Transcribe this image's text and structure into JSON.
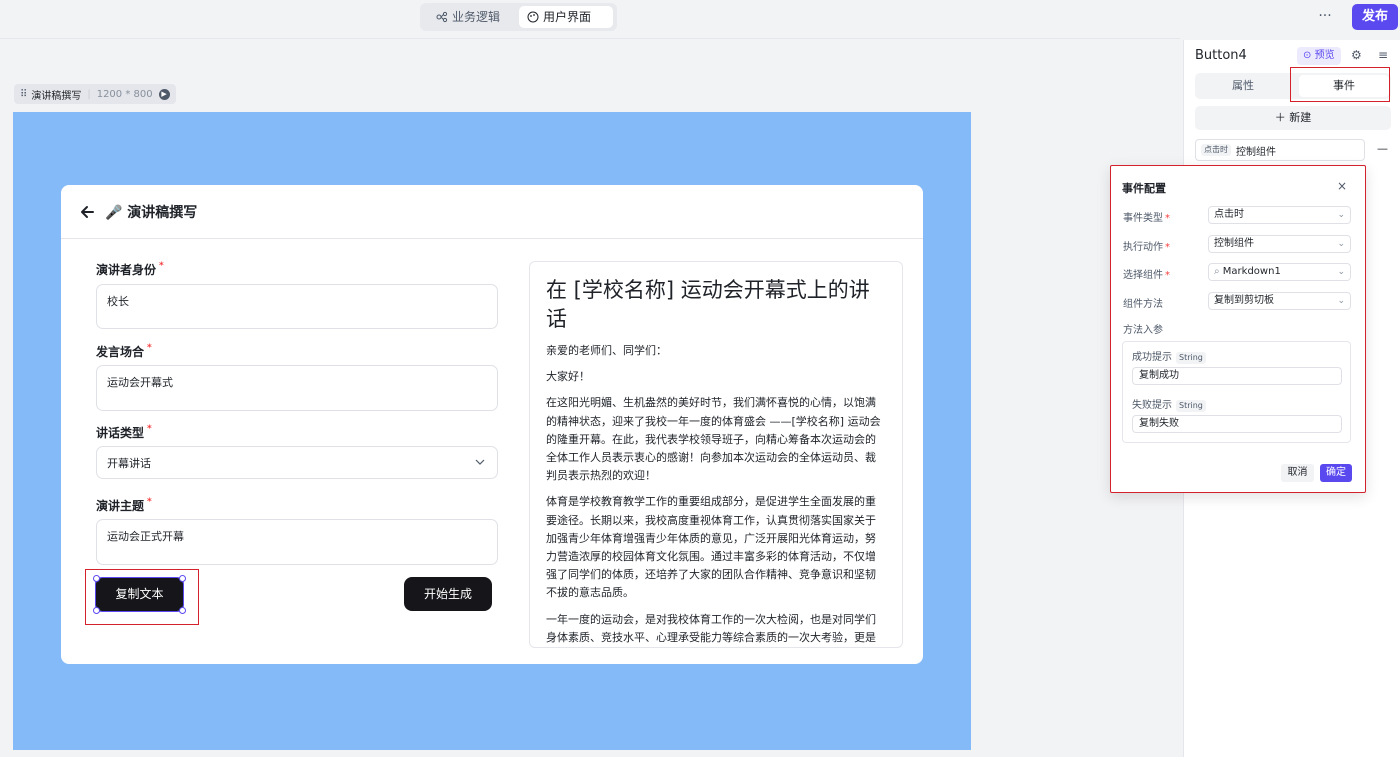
{
  "topbar": {
    "tabs": [
      {
        "label": "业务逻辑",
        "icon": "logic-icon",
        "active": false
      },
      {
        "label": "用户界面",
        "icon": "palette-icon",
        "active": true
      }
    ],
    "more_label": "···",
    "publish_label": "发布"
  },
  "canvas": {
    "page_name": "演讲稿撰写",
    "page_size": "1200 * 800",
    "background_color": "#84baf7"
  },
  "app_card": {
    "title": "🎤 演讲稿撰写",
    "fields": [
      {
        "label": "演讲者身份",
        "value": "校长"
      },
      {
        "label": "发言场合",
        "value": "运动会开幕式"
      },
      {
        "label": "讲话类型",
        "value": "开幕讲话"
      },
      {
        "label": "演讲主题",
        "value": "运动会正式开幕"
      }
    ],
    "copy_button": "复制文本",
    "generate_button": "开始生成",
    "markdown": {
      "heading": "在 [学校名称] 运动会开幕式上的讲话",
      "paragraphs": [
        "亲爱的老师们、同学们：",
        "大家好！",
        "在这阳光明媚、生机盎然的美好时节，我们满怀喜悦的心情，以饱满的精神状态，迎来了我校一年一度的体育盛会 ——[学校名称] 运动会的隆重开幕。在此，我代表学校领导班子，向精心筹备本次运动会的全体工作人员表示衷心的感谢！向参加本次运动会的全体运动员、裁判员表示热烈的欢迎！",
        "体育是学校教育教学工作的重要组成部分，是促进学生全面发展的重要途径。长期以来，我校高度重视体育工作，认真贯彻落实国家关于加强青少年体育增强青少年体质的意见，广泛开展阳光体育运动，努力营造浓厚的校园体育文化氛围。通过丰富多彩的体育活动，不仅增强了同学们的体质，还培养了大家的团队合作精神、竞争意识和坚韧不拔的意志品质。",
        "一年一度的运动会，是对我校体育工作的一次大检阅，也是对同学们身体素质、竞技水平、心理承受能力等综合素质的一次大考验，更是"
      ]
    }
  },
  "right_panel": {
    "component_name": "Button4",
    "preview_label": "预览",
    "tabs": [
      {
        "label": "属性",
        "active": false
      },
      {
        "label": "事件",
        "active": true
      }
    ],
    "new_label": "新建",
    "event_item": {
      "tag": "点击时",
      "label": "控制组件"
    },
    "remove_label": "—"
  },
  "event_popup": {
    "title": "事件配置",
    "rows": [
      {
        "label": "事件类型",
        "required": "*",
        "value": "点击时"
      },
      {
        "label": "执行动作",
        "required": "*",
        "value": "控制组件"
      },
      {
        "label": "选择组件",
        "required": "*",
        "value": "Markdown1"
      },
      {
        "label": "组件方法",
        "required": "",
        "value": "复制到剪切板"
      }
    ],
    "params_label": "方法入参",
    "params": [
      {
        "label": "成功提示",
        "type": "String",
        "value": "复制成功"
      },
      {
        "label": "失败提示",
        "type": "String",
        "value": "复制失败"
      }
    ],
    "cancel_label": "取消",
    "confirm_label": "确定"
  },
  "colors": {
    "accent": "#5b49f0",
    "highlight_box": "#d4212b",
    "required": "#f53f3f"
  }
}
